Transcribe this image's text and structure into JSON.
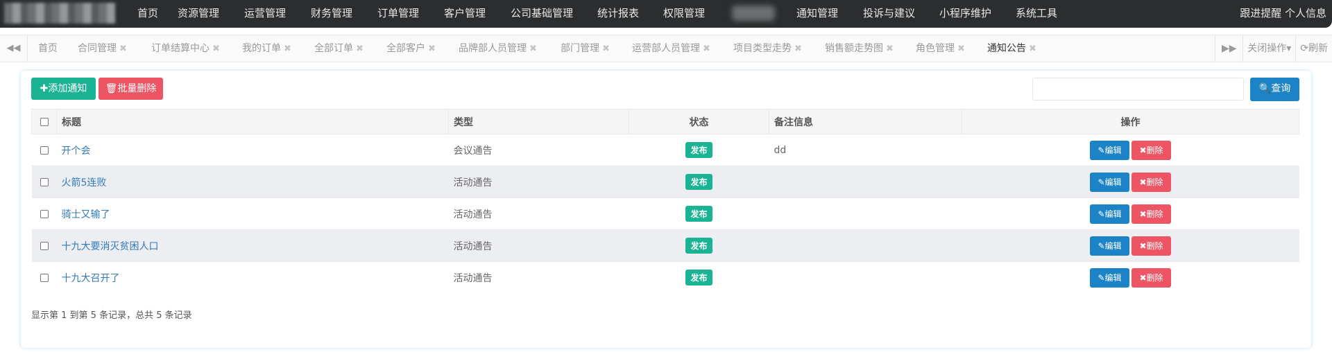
{
  "topnav": {
    "items": [
      "首页",
      "资源管理",
      "运营管理",
      "财务管理",
      "订单管理",
      "客户管理",
      "公司基础管理",
      "统计报表",
      "权限管理",
      "通知管理",
      "投诉与建议",
      "小程序维护",
      "系统工具"
    ],
    "right": "跟进提醒 个人信息"
  },
  "tabs": {
    "items": [
      "首页",
      "合同管理",
      "订单结算中心",
      "我的订单",
      "全部订单",
      "全部客户",
      "品牌部人员管理",
      "部门管理",
      "运营部人员管理",
      "项目类型走势",
      "销售额走势图",
      "角色管理",
      "通知公告"
    ],
    "close_ops": "关闭操作",
    "refresh": "刷新"
  },
  "toolbar": {
    "add_label": "添加通知",
    "batch_delete_label": "批量删除",
    "search_label": "查询",
    "search_value": ""
  },
  "table": {
    "headers": {
      "title": "标题",
      "type": "类型",
      "status": "状态",
      "remark": "备注信息",
      "ops": "操作"
    },
    "rows": [
      {
        "title": "开个会",
        "type": "会议通告",
        "status": "发布",
        "remark": "dd"
      },
      {
        "title": "火箭5连败",
        "type": "活动通告",
        "status": "发布",
        "remark": ""
      },
      {
        "title": "骑士又输了",
        "type": "活动通告",
        "status": "发布",
        "remark": ""
      },
      {
        "title": "十九大要消灭贫困人口",
        "type": "活动通告",
        "status": "发布",
        "remark": ""
      },
      {
        "title": "十九大召开了",
        "type": "活动通告",
        "status": "发布",
        "remark": ""
      }
    ],
    "edit_label": "编辑",
    "delete_label": "删除"
  },
  "pagination": {
    "summary": "显示第 1 到第 5 条记录，总共 5 条记录"
  },
  "colors": {
    "nav_bg": "#2b2d2f",
    "primary": "#1c84c6",
    "success": "#1ab394",
    "danger": "#ed5565"
  },
  "icons": {
    "scroll_left": "double-chevron-left-icon",
    "scroll_right": "double-chevron-right-icon",
    "refresh": "refresh-icon",
    "search": "search-icon",
    "add": "plus-icon",
    "trash": "trash-icon",
    "edit": "edit-icon",
    "remove": "x-icon"
  }
}
